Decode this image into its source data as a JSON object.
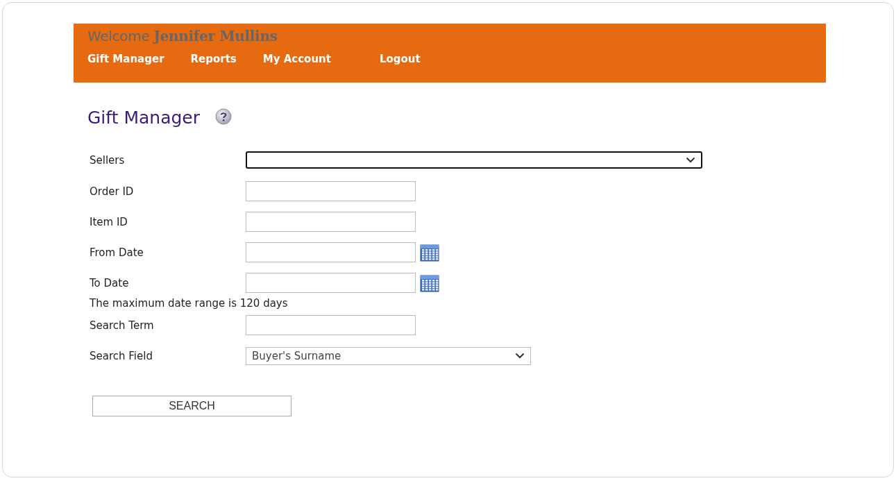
{
  "header": {
    "greeting": "Welcome",
    "user_name": "Jennifer Mullins",
    "nav": [
      {
        "label": "Gift Manager"
      },
      {
        "label": "Reports"
      },
      {
        "label": "My Account"
      },
      {
        "label": "Logout"
      }
    ]
  },
  "page_title": "Gift Manager",
  "form": [
    {
      "kind": "select",
      "label": "Sellers",
      "wide": true,
      "focused": true
    },
    {
      "kind": "text",
      "label": "Order ID"
    },
    {
      "kind": "text",
      "label": "Item ID"
    },
    {
      "kind": "date",
      "label": "From Date"
    },
    {
      "kind": "date",
      "label": "To Date"
    },
    {
      "kind": "note",
      "label": "The maximum date range is 120 days"
    },
    {
      "kind": "text",
      "label": "Search Term"
    },
    {
      "kind": "select",
      "label": "Search Field",
      "value": "Buyer's Surname",
      "wide": false,
      "focused": false
    }
  ],
  "search_button": "SEARCH"
}
